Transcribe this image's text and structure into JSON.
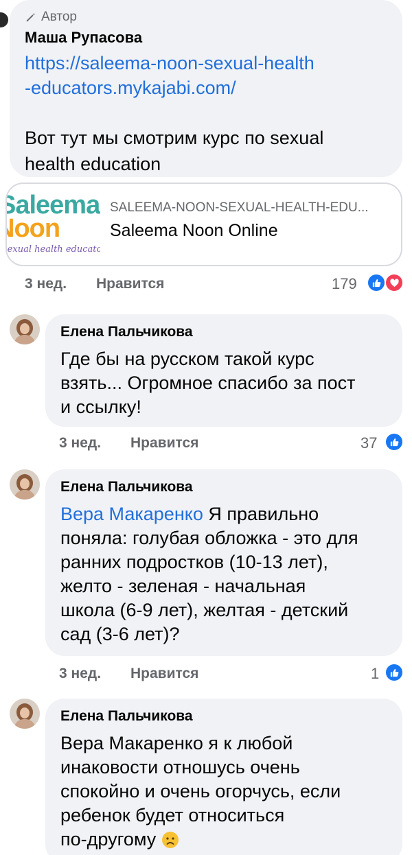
{
  "top_comment": {
    "badge": "Автор",
    "name": "Маша Рупасова",
    "link_line1": "https://saleema-noon-sexual-health",
    "link_line2": "-educators.mykajabi.com/",
    "text_line1": "Вот тут мы смотрим курс по sexual",
    "text_line2": "health education",
    "preview": {
      "logo_line1": "Saleema",
      "logo_line2": "Noon",
      "logo_line3": "sexual health educators",
      "domain": "SALEEMA-NOON-SEXUAL-HEALTH-EDU...",
      "title": "Saleema Noon Online"
    },
    "time": "3 нед.",
    "like_label": "Нравится",
    "reaction_count": "179"
  },
  "replies": [
    {
      "name": "Елена Пальчикова",
      "lines": [
        "Где бы на русском такой курс",
        "взять... Огромное спасибо за пост",
        "и ссылку!"
      ],
      "time": "3 нед.",
      "like_label": "Нравится",
      "reaction_count": "37"
    },
    {
      "name": "Елена Пальчикова",
      "mention": "Вера Макаренко",
      "line1_rest": " Я правильно",
      "lines": [
        "поняла: голубая обложка - это для",
        "ранних подростков (10-13 лет),",
        "желто - зеленая - начальная",
        "школа (6-9 лет), желтая - детский",
        "сад (3-6 лет)?"
      ],
      "time": "3 нед.",
      "like_label": "Нравится",
      "reaction_count": "1"
    },
    {
      "name": "Елена Пальчикова",
      "lines": [
        "Вера Макаренко я к любой",
        "инаковости отношусь очень",
        "спокойно и очень огорчусь, если",
        "ребенок будет относиться",
        "по-другому"
      ]
    }
  ],
  "colors": {
    "bubble": "#f0f2f5",
    "link": "#216fdb",
    "meta": "#65676b",
    "like_blue": "#1877f2",
    "love_red": "#f33e58"
  },
  "icons": [
    "pencil-icon",
    "like-reaction-icon",
    "love-reaction-icon",
    "sad-emoji-icon"
  ]
}
